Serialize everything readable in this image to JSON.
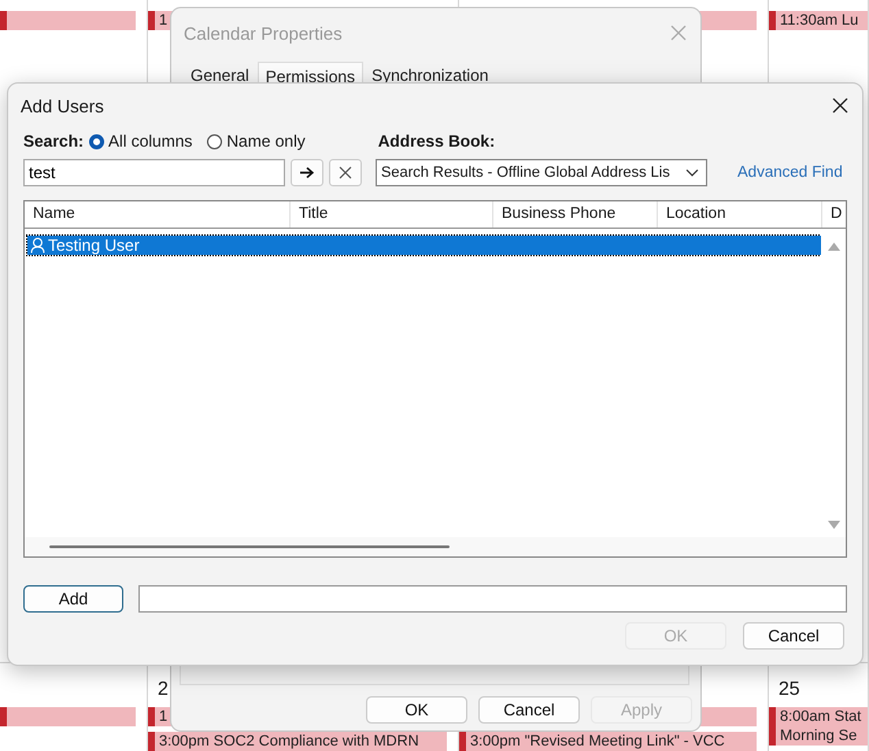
{
  "calendar": {
    "weeks": [
      {
        "cells": [
          {
            "events": [
              {
                "kind": "bar"
              }
            ]
          },
          {
            "events": [
              {
                "kind": "text",
                "lines": [
                  "1"
                ]
              }
            ]
          },
          {
            "events": [
              {
                "kind": "bar"
              }
            ]
          },
          {
            "events": [
              {
                "kind": "text",
                "lines": [
                  "11:30am Lu"
                ]
              }
            ]
          }
        ]
      },
      {
        "cells": [
          {
            "events": [
              {
                "kind": "bar"
              }
            ]
          },
          {
            "day": "2",
            "events": [
              {
                "kind": "text",
                "lines": [
                  "1"
                ]
              },
              {
                "kind": "text",
                "lines": [
                  "3:00pm SOC2 Compliance with MDRN"
                ]
              }
            ]
          },
          {
            "events": [
              {
                "kind": "bar"
              },
              {
                "kind": "text",
                "lines": [
                  "3:00pm \"Revised Meeting Link\"  - VCC"
                ]
              }
            ]
          },
          {
            "day": "25",
            "events": [
              {
                "kind": "text",
                "lines": [
                  "8:00am Stat",
                  "Morning Se"
                ]
              }
            ]
          }
        ]
      }
    ]
  },
  "calendar_properties": {
    "title": "Calendar Properties",
    "tabs": [
      {
        "label": "General",
        "selected": false
      },
      {
        "label": "Permissions",
        "selected": true
      },
      {
        "label": "Synchronization",
        "selected": false
      }
    ],
    "buttons": [
      {
        "label": "OK",
        "disabled": false
      },
      {
        "label": "Cancel",
        "disabled": false
      },
      {
        "label": "Apply",
        "disabled": true
      }
    ]
  },
  "add_users": {
    "title": "Add Users",
    "search": {
      "label": "Search:",
      "options": [
        {
          "label": "All columns",
          "selected": true
        },
        {
          "label": "Name only",
          "selected": false
        }
      ],
      "value": "test"
    },
    "address_book": {
      "label": "Address Book:",
      "value": "Search Results - Offline Global Address Lis"
    },
    "advanced_find": "Advanced Find",
    "table": {
      "columns": [
        "Name",
        "Title",
        "Business Phone",
        "Location",
        "D"
      ],
      "rows": [
        {
          "name": "Testing User",
          "selected": true
        }
      ]
    },
    "add_button": "Add",
    "buttons": [
      {
        "label": "OK",
        "disabled": true
      },
      {
        "label": "Cancel",
        "disabled": false
      }
    ]
  }
}
